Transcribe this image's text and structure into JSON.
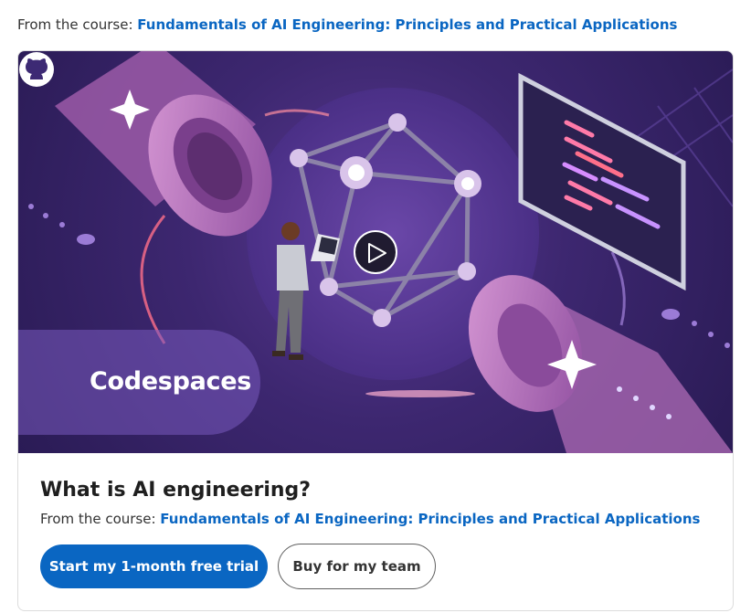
{
  "header": {
    "prefix": "From the course:",
    "course_link": "Fundamentals of AI Engineering: Principles and Practical Applications"
  },
  "video": {
    "brand_name": "Codespaces",
    "play_icon": "play-icon",
    "logo_icon": "github-icon",
    "colors": {
      "background": "#3d2770",
      "accent_pink": "#c780c9",
      "accent_purple": "#7b5cc4"
    }
  },
  "card": {
    "title": "What is AI engineering?",
    "prefix": "From the course:",
    "course_link": "Fundamentals of AI Engineering: Principles and Practical Applications"
  },
  "actions": {
    "primary_label": "Start my 1-month free trial",
    "secondary_label": "Buy for my team"
  },
  "colors": {
    "link": "#0a66c2",
    "primary_button": "#0a66c2"
  }
}
